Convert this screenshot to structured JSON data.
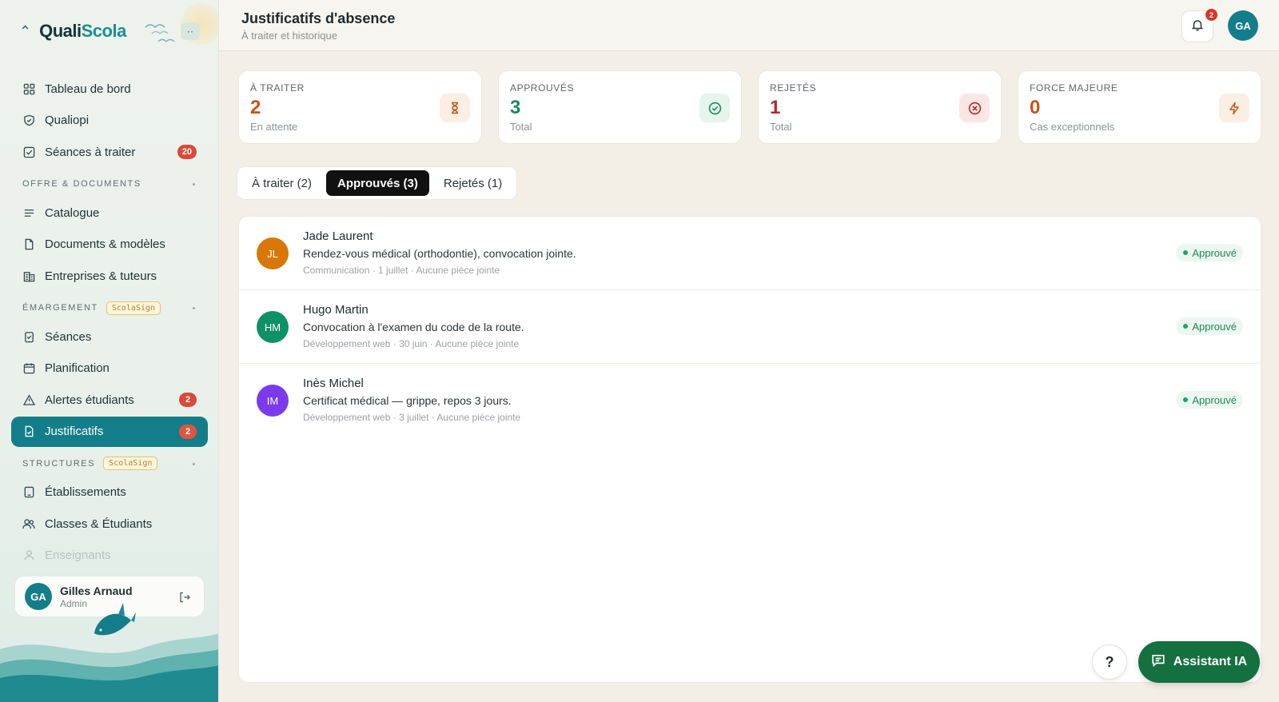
{
  "brand": {
    "name_part1": "Quali",
    "name_part2": "Scola",
    "collapse_glyph": "··"
  },
  "sidebar": {
    "items_top": [
      {
        "label": "Tableau de bord",
        "icon": "grid-icon"
      },
      {
        "label": "Qualiopi",
        "icon": "shield-icon"
      },
      {
        "label": "Séances à traiter",
        "icon": "checkbox-icon",
        "badge": "20"
      }
    ],
    "section_offre": {
      "label": "OFFRE & DOCUMENTS"
    },
    "items_offre": [
      {
        "label": "Catalogue",
        "icon": "list-icon"
      },
      {
        "label": "Documents & modèles",
        "icon": "document-icon"
      },
      {
        "label": "Entreprises & tuteurs",
        "icon": "building-icon"
      }
    ],
    "section_emargement": {
      "label": "ÉMARGEMENT",
      "tag": "ScolaSign"
    },
    "items_emargement": [
      {
        "label": "Séances",
        "icon": "clipboard-icon"
      },
      {
        "label": "Planification",
        "icon": "calendar-icon"
      },
      {
        "label": "Alertes étudiants",
        "icon": "warning-icon",
        "badge": "2"
      },
      {
        "label": "Justificatifs",
        "icon": "file-check-icon",
        "badge": "2",
        "active": true
      }
    ],
    "section_structures": {
      "label": "STRUCTURES",
      "tag": "ScolaSign"
    },
    "items_structures": [
      {
        "label": "Établissements",
        "icon": "tablet-icon"
      },
      {
        "label": "Classes & Étudiants",
        "icon": "users-icon"
      },
      {
        "label": "Enseignants",
        "icon": "user-icon"
      }
    ],
    "user": {
      "initials": "GA",
      "name": "Gilles Arnaud",
      "role": "Admin"
    }
  },
  "header": {
    "title": "Justificatifs d'absence",
    "subtitle": "À traiter et historique",
    "notifications": "2",
    "avatar_initials": "GA"
  },
  "stats": [
    {
      "label": "À TRAITER",
      "value": "2",
      "sub": "En attente",
      "color": "#c2561b",
      "icon": "hourglass-icon",
      "icon_bg": "#fbeee2"
    },
    {
      "label": "APPROUVÉS",
      "value": "3",
      "sub": "Total",
      "color": "#1e8a57",
      "icon": "check-circle-icon",
      "icon_bg": "#e5f4ec"
    },
    {
      "label": "REJETÉS",
      "value": "1",
      "sub": "Total",
      "color": "#b8282a",
      "icon": "x-circle-icon",
      "icon_bg": "#fbe6e6"
    },
    {
      "label": "FORCE MAJEURE",
      "value": "0",
      "sub": "Cas exceptionnels",
      "color": "#c2561b",
      "icon": "bolt-icon",
      "icon_bg": "#fbeee2"
    }
  ],
  "tabs": [
    {
      "label": "À traiter (2)"
    },
    {
      "label": "Approuvés (3)",
      "active": true
    },
    {
      "label": "Rejetés (1)"
    }
  ],
  "list": [
    {
      "initials": "JL",
      "avatar_color": "#d97706",
      "name": "Jade Laurent",
      "desc": "Rendez-vous médical (orthodontie), convocation jointe.",
      "meta": "Communication · 1 juillet · Aucune pièce jointe",
      "status": "Approuvé"
    },
    {
      "initials": "HM",
      "avatar_color": "#0f9168",
      "name": "Hugo Martin",
      "desc": "Convocation à l'examen du code de la route.",
      "meta": "Développement web · 30 juin · Aucune pièce jointe",
      "status": "Approuvé"
    },
    {
      "initials": "IM",
      "avatar_color": "#7c3aed",
      "name": "Inès Michel",
      "desc": "Certificat médical — grippe, repos 3 jours.",
      "meta": "Développement web · 3 juillet · Aucune pièce jointe",
      "status": "Approuvé"
    }
  ],
  "floating": {
    "help_label": "?",
    "assistant_label": "Assistant IA"
  }
}
